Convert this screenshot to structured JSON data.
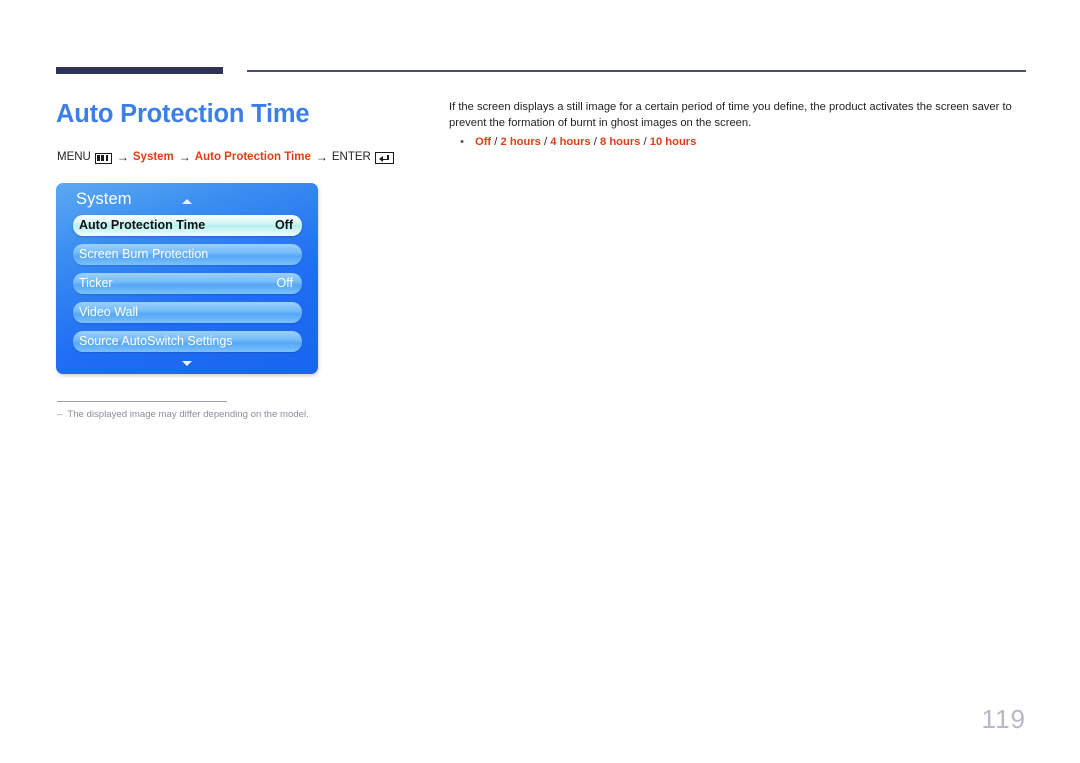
{
  "header": {
    "rule": "decorative-double-rule"
  },
  "page_title": "Auto Protection Time",
  "breadcrumb": {
    "menu_label": "MENU",
    "menu_icon": "menu-grid-icon",
    "arrow": "→",
    "step1": "System",
    "step2": "Auto Protection Time",
    "enter_label": "ENTER",
    "enter_icon": "enter-return-icon"
  },
  "osd": {
    "header": "System",
    "scroll_up_icon": "triangle-up-icon",
    "scroll_down_icon": "triangle-down-icon",
    "rows": [
      {
        "label": "Auto Protection Time",
        "value": "Off",
        "selected": true
      },
      {
        "label": "Screen Burn Protection",
        "value": "",
        "selected": false
      },
      {
        "label": "Ticker",
        "value": "Off",
        "selected": false
      },
      {
        "label": "Video Wall",
        "value": "",
        "selected": false
      },
      {
        "label": "Source AutoSwitch Settings",
        "value": "",
        "selected": false
      }
    ]
  },
  "footnote": {
    "dash": "‒",
    "text": "The displayed image may differ depending on the model."
  },
  "description": "If the screen displays a still image for a certain period of time you define, the product activates the screen saver to prevent the formation of burnt in ghost images on the screen.",
  "bullets": [
    {
      "marker": "•",
      "options": [
        "Off",
        "2 hours",
        "4 hours",
        "8 hours",
        "10 hours"
      ],
      "separator": " / "
    }
  ],
  "page_number": "119",
  "colors": {
    "title_blue": "#3d7fe8",
    "accent_red": "#e03e16",
    "rule_navy": "#2f3356",
    "osd_blue": "#1f6ef4",
    "page_number_grey": "#b8b9c4"
  }
}
